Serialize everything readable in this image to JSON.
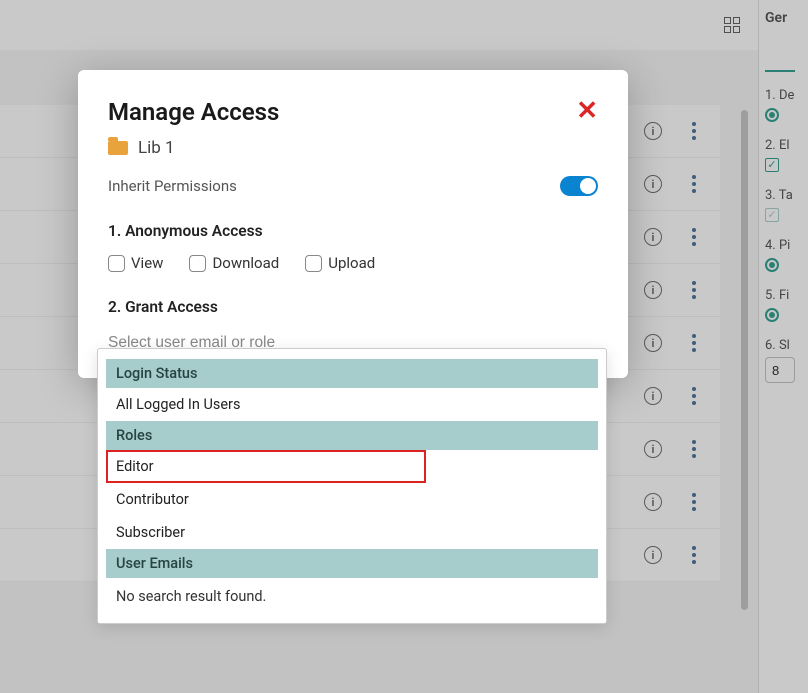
{
  "rightPanel": {
    "title": "Ger",
    "items": [
      {
        "label": "1. De",
        "control": "radio"
      },
      {
        "label": "2. El",
        "control": "checkbox"
      },
      {
        "label": "3. Ta",
        "control": "checkbox-light"
      },
      {
        "label": "4. Pi",
        "control": "radio"
      },
      {
        "label": "5. Fi",
        "control": "radio"
      },
      {
        "label": "6. Sl",
        "control": "number",
        "value": "8"
      }
    ]
  },
  "modal": {
    "title": "Manage Access",
    "folderName": "Lib 1",
    "inheritLabel": "Inherit Permissions",
    "inheritOn": true,
    "section1": "1. Anonymous Access",
    "checkboxes": {
      "view": "View",
      "download": "Download",
      "upload": "Upload"
    },
    "section2": "2. Grant Access",
    "inputPlaceholder": "Select user email or role"
  },
  "dropdown": {
    "group1": "Login Status",
    "item_allLoggedIn": "All Logged In Users",
    "group2": "Roles",
    "item_editor": "Editor",
    "item_contributor": "Contributor",
    "item_subscriber": "Subscriber",
    "group3": "User Emails",
    "noResult": "No search result found."
  }
}
